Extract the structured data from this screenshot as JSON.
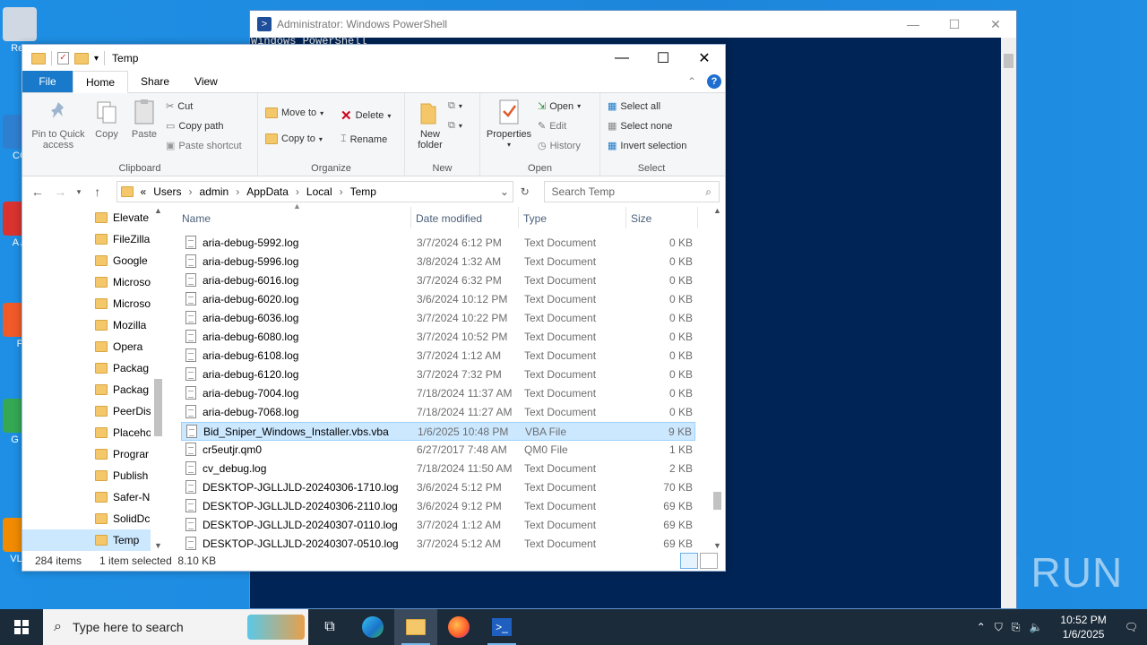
{
  "desktop": {
    "icons": [
      {
        "label": "Rec",
        "color": "#cfd8e3"
      },
      {
        "label": "CC",
        "color": "#2f7fd1"
      },
      {
        "label": "A A",
        "color": "#d8332f"
      },
      {
        "label": "F",
        "color": "#f05a28"
      },
      {
        "label": "G C",
        "color": "#34a853"
      },
      {
        "label": "VLC",
        "color": "#f08a00"
      }
    ],
    "watermark": "ANY RUN"
  },
  "powershell": {
    "title": "Administrator: Windows PowerShell",
    "text_line": "Windows PowerShell"
  },
  "explorer": {
    "title": "Temp",
    "tabs": [
      "File",
      "Home",
      "Share",
      "View"
    ],
    "ribbon": {
      "clipboard": {
        "label": "Clipboard",
        "pin": "Pin to Quick access",
        "copy": "Copy",
        "paste": "Paste",
        "cut": "Cut",
        "copy_path": "Copy path",
        "paste_shortcut": "Paste shortcut"
      },
      "organize": {
        "label": "Organize",
        "move_to": "Move to",
        "copy_to": "Copy to",
        "delete": "Delete",
        "rename": "Rename"
      },
      "new": {
        "label": "New",
        "new_folder": "New folder"
      },
      "open": {
        "label": "Open",
        "properties": "Properties",
        "open": "Open",
        "edit": "Edit",
        "history": "History"
      },
      "select": {
        "label": "Select",
        "select_all": "Select all",
        "select_none": "Select none",
        "invert": "Invert selection"
      }
    },
    "address": {
      "crumbs": [
        "«",
        "Users",
        "admin",
        "AppData",
        "Local",
        "Temp"
      ],
      "search_placeholder": "Search Temp"
    },
    "nav_items": [
      {
        "label": "Elevate",
        "selected": false
      },
      {
        "label": "FileZilla",
        "selected": false
      },
      {
        "label": "Google",
        "selected": false
      },
      {
        "label": "Microso",
        "selected": false
      },
      {
        "label": "Microso",
        "selected": false
      },
      {
        "label": "Mozilla",
        "selected": false
      },
      {
        "label": "Opera",
        "selected": false
      },
      {
        "label": "Packag",
        "selected": false
      },
      {
        "label": "Packag",
        "selected": false
      },
      {
        "label": "PeerDis",
        "selected": false
      },
      {
        "label": "Placeho",
        "selected": false
      },
      {
        "label": "Prograr",
        "selected": false
      },
      {
        "label": "Publish",
        "selected": false
      },
      {
        "label": "Safer-N",
        "selected": false
      },
      {
        "label": "SolidDc",
        "selected": false
      },
      {
        "label": "Temp",
        "selected": true
      }
    ],
    "columns": {
      "name": "Name",
      "date": "Date modified",
      "type": "Type",
      "size": "Size"
    },
    "files": [
      {
        "name": "aria-debug-5992.log",
        "date": "3/7/2024 6:12 PM",
        "type": "Text Document",
        "size": "0 KB"
      },
      {
        "name": "aria-debug-5996.log",
        "date": "3/8/2024 1:32 AM",
        "type": "Text Document",
        "size": "0 KB"
      },
      {
        "name": "aria-debug-6016.log",
        "date": "3/7/2024 6:32 PM",
        "type": "Text Document",
        "size": "0 KB"
      },
      {
        "name": "aria-debug-6020.log",
        "date": "3/6/2024 10:12 PM",
        "type": "Text Document",
        "size": "0 KB"
      },
      {
        "name": "aria-debug-6036.log",
        "date": "3/7/2024 10:22 PM",
        "type": "Text Document",
        "size": "0 KB"
      },
      {
        "name": "aria-debug-6080.log",
        "date": "3/7/2024 10:52 PM",
        "type": "Text Document",
        "size": "0 KB"
      },
      {
        "name": "aria-debug-6108.log",
        "date": "3/7/2024 1:12 AM",
        "type": "Text Document",
        "size": "0 KB"
      },
      {
        "name": "aria-debug-6120.log",
        "date": "3/7/2024 7:32 PM",
        "type": "Text Document",
        "size": "0 KB"
      },
      {
        "name": "aria-debug-7004.log",
        "date": "7/18/2024 11:37 AM",
        "type": "Text Document",
        "size": "0 KB"
      },
      {
        "name": "aria-debug-7068.log",
        "date": "7/18/2024 11:27 AM",
        "type": "Text Document",
        "size": "0 KB"
      },
      {
        "name": "Bid_Sniper_Windows_Installer.vbs.vba",
        "date": "1/6/2025 10:48 PM",
        "type": "VBA File",
        "size": "9 KB",
        "selected": true
      },
      {
        "name": "cr5eutjr.qm0",
        "date": "6/27/2017 7:48 AM",
        "type": "QM0 File",
        "size": "1 KB"
      },
      {
        "name": "cv_debug.log",
        "date": "7/18/2024 11:50 AM",
        "type": "Text Document",
        "size": "2 KB"
      },
      {
        "name": "DESKTOP-JGLLJLD-20240306-1710.log",
        "date": "3/6/2024 5:12 PM",
        "type": "Text Document",
        "size": "70 KB"
      },
      {
        "name": "DESKTOP-JGLLJLD-20240306-2110.log",
        "date": "3/6/2024 9:12 PM",
        "type": "Text Document",
        "size": "69 KB"
      },
      {
        "name": "DESKTOP-JGLLJLD-20240307-0110.log",
        "date": "3/7/2024 1:12 AM",
        "type": "Text Document",
        "size": "69 KB"
      },
      {
        "name": "DESKTOP-JGLLJLD-20240307-0510.log",
        "date": "3/7/2024 5:12 AM",
        "type": "Text Document",
        "size": "69 KB"
      }
    ],
    "status": {
      "items": "284 items",
      "selected": "1 item selected  8.10 KB"
    }
  },
  "taskbar": {
    "search_placeholder": "Type here to search",
    "time": "10:52 PM",
    "date": "1/6/2025"
  }
}
